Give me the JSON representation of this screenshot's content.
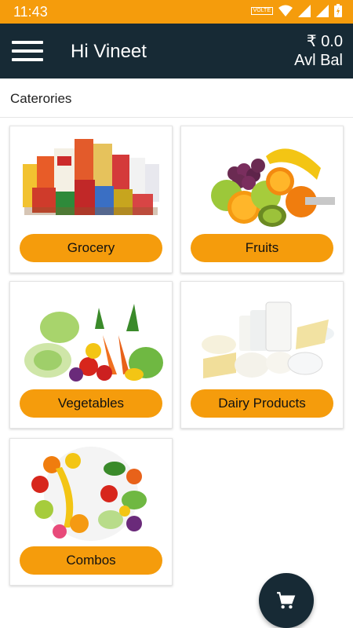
{
  "status_bar": {
    "time": "11:43",
    "icons": [
      "volte-badge-icon",
      "wifi-icon",
      "signal-icon",
      "signal-icon",
      "battery-icon"
    ],
    "volte_label": "VOLTE",
    "color": "#f59c0c"
  },
  "app_bar": {
    "greeting": "Hi Vineet",
    "balance_amount": "₹ 0.0",
    "balance_label": "Avl Bal",
    "color": "#172a35"
  },
  "section_title": "Caterories",
  "categories": [
    {
      "label": "Grocery",
      "image": "grocery-products-image"
    },
    {
      "label": "Fruits",
      "image": "fruits-image"
    },
    {
      "label": "Vegetables",
      "image": "vegetables-image"
    },
    {
      "label": "Dairy Products",
      "image": "dairy-products-image"
    },
    {
      "label": "Combos",
      "image": "combos-image"
    }
  ],
  "fab": {
    "icon": "cart-icon"
  },
  "colors": {
    "accent": "#f59c0c",
    "dark": "#172a35"
  }
}
